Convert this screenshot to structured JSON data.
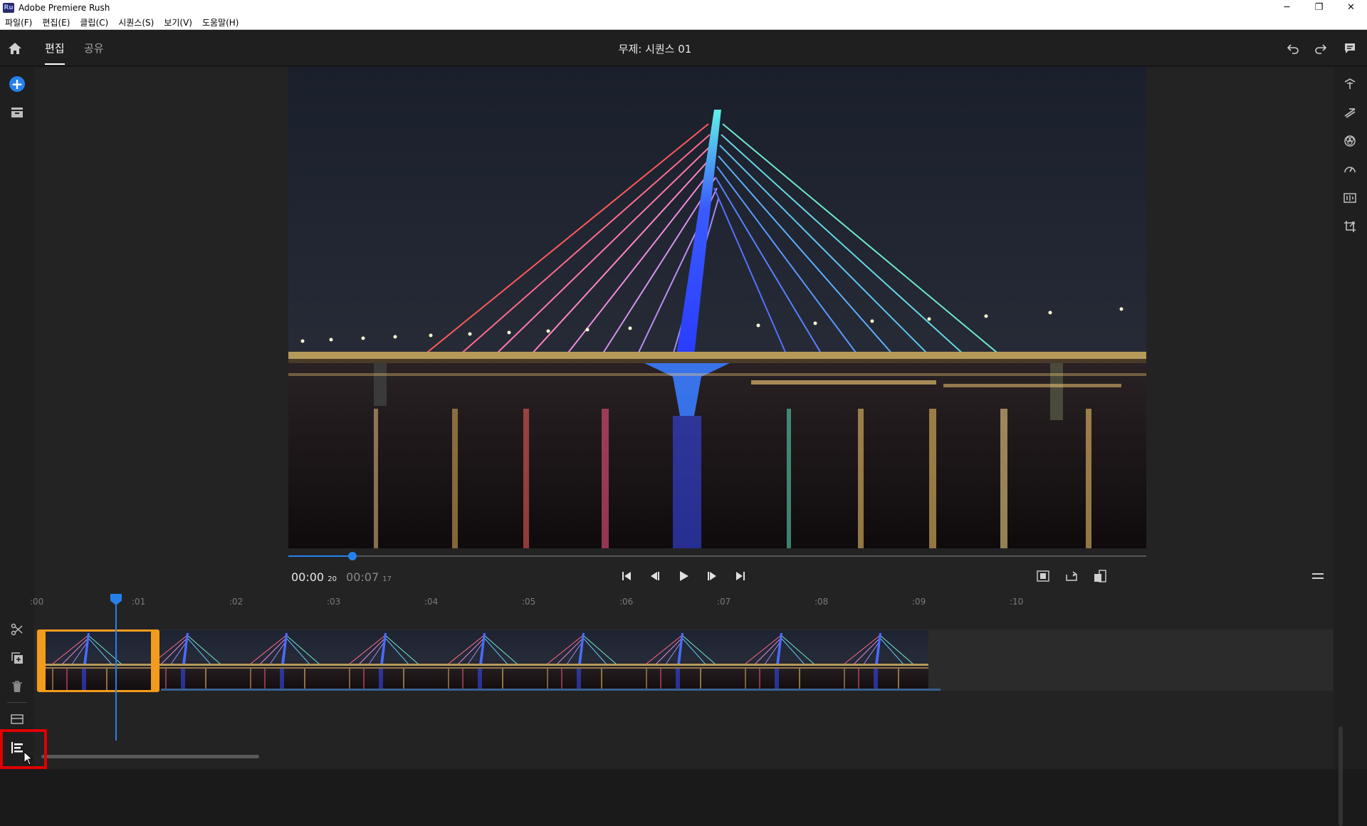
{
  "window": {
    "app_badge": "Ru",
    "title": "Adobe Premiere Rush",
    "controls": [
      "─",
      "❐",
      "✕"
    ]
  },
  "menu": [
    "파일(F)",
    "편집(E)",
    "클립(C)",
    "시퀀스(S)",
    "보기(V)",
    "도움말(H)"
  ],
  "header": {
    "tabs": [
      {
        "label": "편집",
        "active": true
      },
      {
        "label": "공유",
        "active": false
      }
    ],
    "sequence_title": "무제: 시퀀스 01",
    "icons": [
      "home-icon",
      "undo-icon",
      "redo-icon",
      "comment-icon"
    ]
  },
  "left_toolbar": {
    "add_label": "+",
    "tools": [
      "add-media-icon",
      "project-assets-icon",
      "split-icon",
      "duplicate-icon",
      "delete-icon",
      "track-controls-icon",
      "timeline-view-icon"
    ]
  },
  "right_toolbar": [
    "titles-icon",
    "transitions-icon",
    "color-icon",
    "speed-icon",
    "audio-icon",
    "transform-icon"
  ],
  "preview": {
    "current_time": "00:00",
    "current_frames": "20",
    "duration_time": "00:07",
    "duration_frames": "17",
    "progress": 0.075,
    "transport": [
      "skip-to-start-icon",
      "step-back-icon",
      "play-icon",
      "step-forward-icon",
      "skip-to-end-icon"
    ],
    "right_controls": [
      "fit-icon",
      "rotate-icon",
      "aspect-ratio-icon",
      "menu-icon"
    ]
  },
  "ruler": {
    "labels": [
      ":00",
      ":01",
      ":02",
      ":03",
      ":04",
      ":05",
      ":06",
      ":07",
      ":08",
      ":09",
      ":10"
    ]
  },
  "timeline": {
    "thumbnail_count": 9,
    "selected_clip": "bridge-night-clip"
  },
  "colors": {
    "accent": "#2680eb",
    "selection": "#f29b1d",
    "highlight": "#e10000",
    "background": "#232323"
  }
}
